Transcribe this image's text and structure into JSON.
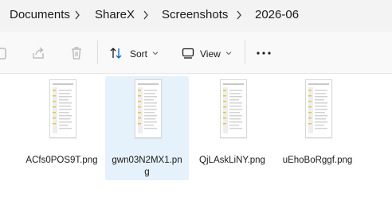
{
  "breadcrumb": {
    "items": [
      "Documents",
      "ShareX",
      "Screenshots",
      "2026-06"
    ]
  },
  "toolbar": {
    "sort_label": "Sort",
    "view_label": "View"
  },
  "files": [
    {
      "name": "ACfs0POS9T.png",
      "selected": false
    },
    {
      "name_line1": "gwn03N2MX1.pn",
      "name_line2": "g",
      "selected": true
    },
    {
      "name": "QjLAskLiNY.png",
      "selected": false
    },
    {
      "name": "uEhoBoRggf.png",
      "selected": false
    }
  ],
  "colors": {
    "selection": "#e5f1fb",
    "accent": "#0067c0"
  }
}
